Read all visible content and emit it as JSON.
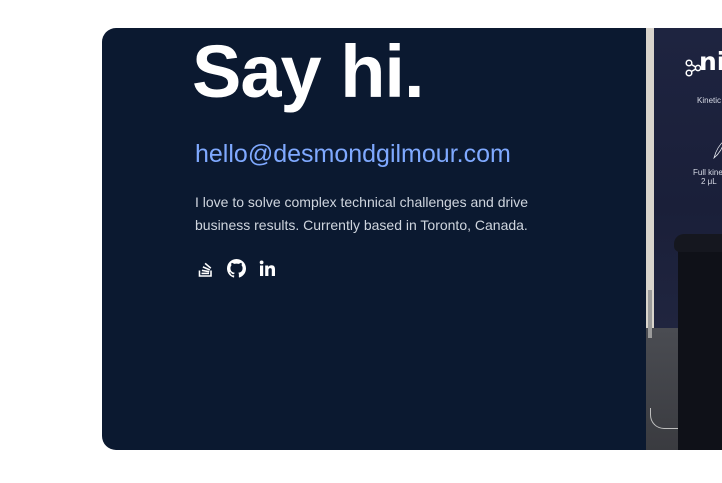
{
  "contact": {
    "heading": "Say hi.",
    "email": "hello@desmondgilmour.com",
    "bio": "I love to solve complex technical challenges and drive business results. Currently based in Toronto, Canada.",
    "social": [
      {
        "icon": "stack-overflow-icon"
      },
      {
        "icon": "github-icon"
      },
      {
        "icon": "linkedin-icon"
      }
    ]
  },
  "photo": {
    "logo_text": "ni",
    "line1": "Kinetic",
    "line2": "Full kine",
    "line3": "2 μL"
  },
  "colors": {
    "card_background": "#0b1930",
    "email_link": "#7fa9ff",
    "heading": "#ffffff",
    "body_text": "#cfd5de"
  }
}
